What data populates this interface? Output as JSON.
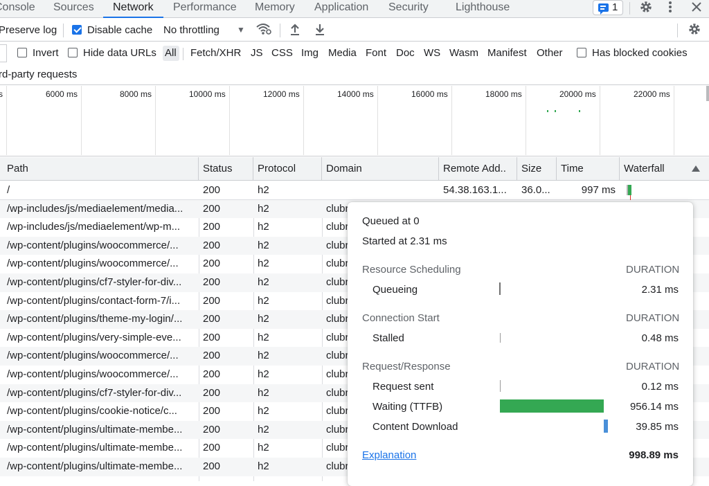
{
  "tabs": {
    "console": "Console",
    "sources": "Sources",
    "network": "Network",
    "performance": "Performance",
    "memory": "Memory",
    "application": "Application",
    "security": "Security",
    "lighthouse": "Lighthouse",
    "issues_count": "1"
  },
  "toolbar": {
    "preserve_log": "Preserve log",
    "disable_cache": "Disable cache",
    "throttling": "No throttling"
  },
  "filters": {
    "invert": "Invert",
    "hide_data_urls": "Hide data URLs",
    "types": [
      "All",
      "Fetch/XHR",
      "JS",
      "CSS",
      "Img",
      "Media",
      "Font",
      "Doc",
      "WS",
      "Wasm",
      "Manifest",
      "Other"
    ],
    "has_blocked_cookies": "Has blocked cookies",
    "third_party": "rd-party requests"
  },
  "overview": {
    "labels": [
      "s",
      "6000 ms",
      "8000 ms",
      "10000 ms",
      "12000 ms",
      "14000 ms",
      "16000 ms",
      "18000 ms",
      "20000 ms",
      "22000 ms"
    ]
  },
  "table": {
    "headers": [
      "Path",
      "Status",
      "Protocol",
      "Domain",
      "Remote Add..",
      "Size",
      "Time",
      "Waterfall"
    ],
    "rows": [
      {
        "path": "/",
        "status": "200",
        "protocol": "h2",
        "domain": "",
        "remote": "54.38.163.1...",
        "size": "36.0...",
        "time": "997 ms"
      },
      {
        "path": "/wp-includes/js/mediaelement/media...",
        "status": "200",
        "protocol": "h2",
        "domain": "clubr"
      },
      {
        "path": "/wp-includes/js/mediaelement/wp-m...",
        "status": "200",
        "protocol": "h2",
        "domain": "clubr"
      },
      {
        "path": "/wp-content/plugins/woocommerce/...",
        "status": "200",
        "protocol": "h2",
        "domain": "clubr"
      },
      {
        "path": "/wp-content/plugins/woocommerce/...",
        "status": "200",
        "protocol": "h2",
        "domain": "clubr"
      },
      {
        "path": "/wp-content/plugins/cf7-styler-for-div...",
        "status": "200",
        "protocol": "h2",
        "domain": "clubr"
      },
      {
        "path": "/wp-content/plugins/contact-form-7/i...",
        "status": "200",
        "protocol": "h2",
        "domain": "clubr"
      },
      {
        "path": "/wp-content/plugins/theme-my-login/...",
        "status": "200",
        "protocol": "h2",
        "domain": "clubr"
      },
      {
        "path": "/wp-content/plugins/very-simple-eve...",
        "status": "200",
        "protocol": "h2",
        "domain": "clubr"
      },
      {
        "path": "/wp-content/plugins/woocommerce/...",
        "status": "200",
        "protocol": "h2",
        "domain": "clubr"
      },
      {
        "path": "/wp-content/plugins/woocommerce/...",
        "status": "200",
        "protocol": "h2",
        "domain": "clubr"
      },
      {
        "path": "/wp-content/plugins/cf7-styler-for-div...",
        "status": "200",
        "protocol": "h2",
        "domain": "clubr"
      },
      {
        "path": "/wp-content/plugins/cookie-notice/c...",
        "status": "200",
        "protocol": "h2",
        "domain": "clubr"
      },
      {
        "path": "/wp-content/plugins/ultimate-membe...",
        "status": "200",
        "protocol": "h2",
        "domain": "clubr"
      },
      {
        "path": "/wp-content/plugins/ultimate-membe...",
        "status": "200",
        "protocol": "h2",
        "domain": "clubr"
      },
      {
        "path": "/wp-content/plugins/ultimate-membe...",
        "status": "200",
        "protocol": "h2",
        "domain": "clubr"
      }
    ]
  },
  "tooltip": {
    "queued": "Queued at 0",
    "started": "Started at 2.31 ms",
    "sections": [
      {
        "title": "Resource Scheduling",
        "duration_label": "DURATION",
        "items": [
          {
            "label": "Queueing",
            "value": "2.31 ms"
          }
        ]
      },
      {
        "title": "Connection Start",
        "duration_label": "DURATION",
        "items": [
          {
            "label": "Stalled",
            "value": "0.48 ms"
          }
        ]
      },
      {
        "title": "Request/Response",
        "duration_label": "DURATION",
        "items": [
          {
            "label": "Request sent",
            "value": "0.12 ms"
          },
          {
            "label": "Waiting (TTFB)",
            "value": "956.14 ms"
          },
          {
            "label": "Content Download",
            "value": "39.85 ms"
          }
        ]
      }
    ],
    "explanation": "Explanation",
    "total": "998.89 ms"
  },
  "colors": {
    "accent": "#1a73e8",
    "ttfb": "#34a853",
    "download": "#4a90d9"
  }
}
